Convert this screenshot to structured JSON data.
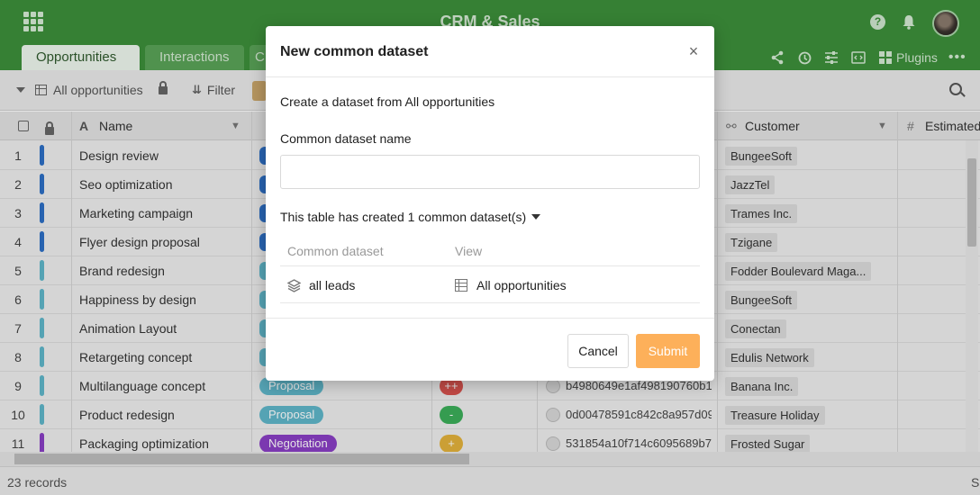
{
  "app": {
    "title": "CRM & Sales",
    "tabs": [
      {
        "label": "Opportunities",
        "active": true
      },
      {
        "label": "Interactions",
        "active": false
      },
      {
        "label": "C",
        "active": false
      }
    ],
    "plugins_label": "Plugins",
    "icons": [
      "apps-grid-icon",
      "help-icon",
      "bell-icon",
      "avatar",
      "share-icon",
      "history-icon",
      "settings-sliders-icon",
      "code-icon",
      "plugins-icon",
      "more-icon"
    ]
  },
  "viewbar": {
    "view_name": "All opportunities",
    "filter_label": "Filter"
  },
  "table": {
    "columns": [
      {
        "label": "Name"
      },
      {
        "label": "Customer"
      },
      {
        "label": "Estimated"
      }
    ],
    "rows": [
      {
        "num": "1",
        "name": "Design review",
        "bar": "#2d6fc4",
        "stage": "",
        "stage_color": "#2d6fc4",
        "rating": "",
        "rating_color": "",
        "hash": "",
        "customer": "BungeeSoft"
      },
      {
        "num": "2",
        "name": "Seo optimization",
        "bar": "#2d6fc4",
        "stage": "",
        "stage_color": "#2d6fc4",
        "rating": "",
        "rating_color": "",
        "hash": "",
        "customer": "JazzTel"
      },
      {
        "num": "3",
        "name": "Marketing campaign",
        "bar": "#2d6fc4",
        "stage": "",
        "stage_color": "#2d6fc4",
        "rating": "",
        "rating_color": "",
        "hash": "",
        "customer": "Trames Inc."
      },
      {
        "num": "4",
        "name": "Flyer design proposal",
        "bar": "#2d6fc4",
        "stage": "",
        "stage_color": "#2d6fc4",
        "rating": "",
        "rating_color": "",
        "hash": "",
        "customer": "Tzigane"
      },
      {
        "num": "5",
        "name": "Brand redesign",
        "bar": "#5fb6c9",
        "stage": "",
        "stage_color": "#5fb6c9",
        "rating": "",
        "rating_color": "",
        "hash": "",
        "customer": "Fodder Boulevard Maga..."
      },
      {
        "num": "6",
        "name": "Happiness by design",
        "bar": "#5fb6c9",
        "stage": "",
        "stage_color": "#5fb6c9",
        "rating": "",
        "rating_color": "",
        "hash": "",
        "customer": "BungeeSoft"
      },
      {
        "num": "7",
        "name": "Animation Layout",
        "bar": "#5fb6c9",
        "stage": "",
        "stage_color": "#5fb6c9",
        "rating": "",
        "rating_color": "",
        "hash": "",
        "customer": "Conectan"
      },
      {
        "num": "8",
        "name": "Retargeting concept",
        "bar": "#5fb6c9",
        "stage": "",
        "stage_color": "#5fb6c9",
        "rating": "",
        "rating_color": "",
        "hash": "",
        "customer": "Edulis Network"
      },
      {
        "num": "9",
        "name": "Multilanguage concept",
        "bar": "#5fb6c9",
        "stage": "Proposal",
        "stage_color": "#5fb6c9",
        "rating": "++",
        "rating_color": "#d9534f",
        "hash": "b4980649e1af498190760b1",
        "customer": "Banana Inc."
      },
      {
        "num": "10",
        "name": "Product redesign",
        "bar": "#5fb6c9",
        "stage": "Proposal",
        "stage_color": "#5fb6c9",
        "rating": "-",
        "rating_color": "#3cae5a",
        "hash": "0d00478591c842c8a957d09",
        "customer": "Treasure Holiday"
      },
      {
        "num": "11",
        "name": "Packaging optimization",
        "bar": "#8a3fc4",
        "stage": "Negotiation",
        "stage_color": "#8a3fc4",
        "rating": "+",
        "rating_color": "#e3b23c",
        "hash": "531854a10f714c6095689b7",
        "customer": "Frosted Sugar"
      }
    ]
  },
  "footer": {
    "record_count": "23 records",
    "right_stub": "S"
  },
  "modal": {
    "title": "New common dataset",
    "close_glyph": "×",
    "subtitle": "Create a dataset from All opportunities",
    "name_label": "Common dataset name",
    "name_value": "",
    "name_placeholder": "",
    "existing_toggle": "This table has created 1 common dataset(s)",
    "col_dataset": "Common dataset",
    "col_view": "View",
    "datasets": [
      {
        "name": "all leads",
        "view": "All opportunities"
      }
    ],
    "cancel_label": "Cancel",
    "submit_label": "Submit",
    "submit_color": "#fdb05a"
  }
}
